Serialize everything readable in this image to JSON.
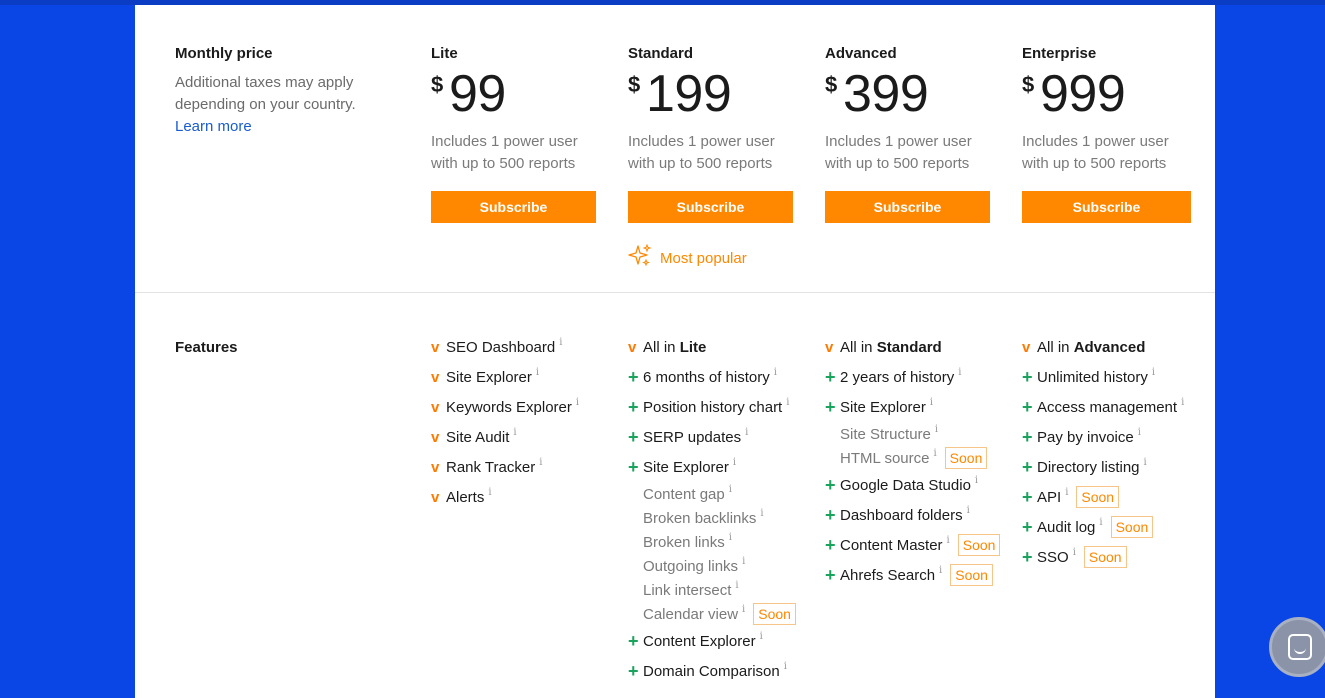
{
  "pricing": {
    "monthly_label": "Monthly price",
    "taxes_note": "Additional taxes may apply depending on your country.",
    "learn_more": "Learn more",
    "currency": "$",
    "plans": [
      {
        "name": "Lite",
        "price": "99",
        "includes": "Includes 1 power user with up to 500 reports",
        "button": "Subscribe"
      },
      {
        "name": "Standard",
        "price": "199",
        "includes": "Includes 1 power user with up to 500 reports",
        "button": "Subscribe"
      },
      {
        "name": "Advanced",
        "price": "399",
        "includes": "Includes 1 power user with up to 500 reports",
        "button": "Subscribe"
      },
      {
        "name": "Enterprise",
        "price": "999",
        "includes": "Includes 1 power user with up to 500 reports",
        "button": "Subscribe"
      }
    ],
    "most_popular": "Most popular"
  },
  "features": {
    "label": "Features",
    "info_glyph": "i",
    "soon": "Soon",
    "lite": [
      "SEO Dashboard",
      "Site Explorer",
      "Keywords Explorer",
      "Site Audit",
      "Rank Tracker",
      "Alerts"
    ],
    "standard": {
      "all_in_prefix": "All in",
      "all_in_plan": "Lite",
      "items": [
        "6 months of history",
        "Position history chart",
        "SERP updates",
        "Site Explorer"
      ],
      "site_explorer_sub": [
        "Content gap",
        "Broken backlinks",
        "Broken links",
        "Outgoing links",
        "Link intersect",
        "Calendar view"
      ],
      "items_after": [
        "Content Explorer",
        "Domain Comparison"
      ]
    },
    "advanced": {
      "all_in_prefix": "All in",
      "all_in_plan": "Standard",
      "items": [
        "2 years of history",
        "Site Explorer"
      ],
      "site_explorer_sub": [
        "Site Structure",
        "HTML source"
      ],
      "items_after": [
        "Google Data Studio",
        "Dashboard folders",
        "Content Master",
        "Ahrefs Search"
      ]
    },
    "enterprise": {
      "all_in_prefix": "All in",
      "all_in_plan": "Advanced",
      "items": [
        "Unlimited history",
        "Access management",
        "Pay by invoice",
        "Directory listing",
        "API",
        "Audit log",
        "SSO"
      ]
    }
  },
  "icons": {
    "check": "check-icon",
    "plus": "plus-icon",
    "info": "info-icon",
    "sparkle": "sparkle-icon",
    "chat": "chat-icon"
  },
  "colors": {
    "background": "#0a46e6",
    "accent": "#ff8800",
    "plus": "#1aa35c",
    "link": "#1a5ccf"
  }
}
